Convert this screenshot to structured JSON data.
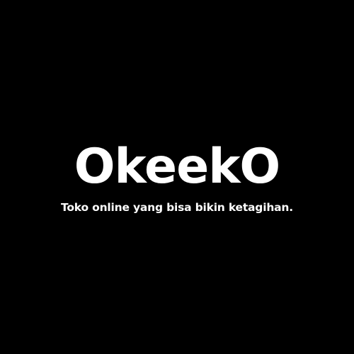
{
  "brand": {
    "name": "OkeekO",
    "tagline": "Toko online yang bisa bikin ketagihan."
  },
  "colors": {
    "background": "#000000",
    "text": "#ffffff"
  }
}
